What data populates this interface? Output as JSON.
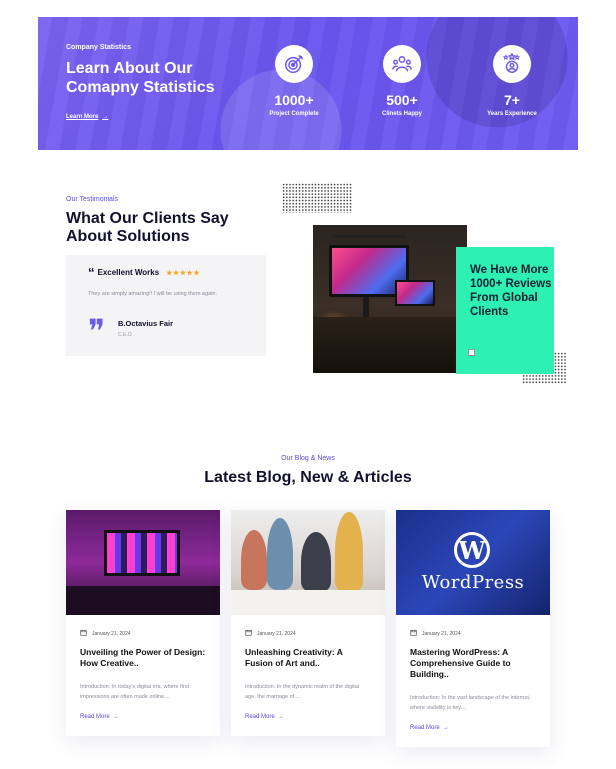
{
  "stats": {
    "kicker": "Company Statistics",
    "title": "Learn About Our Comapny Statistics",
    "learn_more": "Learn More",
    "items": [
      {
        "icon": "target-icon",
        "value": "1000+",
        "label": "Project Complete"
      },
      {
        "icon": "team-icon",
        "value": "500+",
        "label": "Clinets Happy"
      },
      {
        "icon": "award-icon",
        "value": "7+",
        "label": "Years Experience"
      }
    ]
  },
  "testimonials": {
    "kicker": "Our Testimonials",
    "title": "What Our Clients Say About Solutions",
    "card": {
      "heading": "Excellent Works",
      "rating": 5,
      "text": "They are simply amazing!! I will be using them again.",
      "name": "B.Octavius Fair",
      "role": "C.E.O"
    },
    "highlight": "We Have More 1000+ Reviews From Global Clients"
  },
  "blog": {
    "kicker": "Our Blog & News",
    "title": "Latest Blog, New & Articles",
    "posts": [
      {
        "date": "January 21, 2024",
        "title": "Unveiling the Power of Design: How Creative..",
        "excerpt": "Introduction: In today's digital era, where first impressions are often made online....",
        "more": "Read More"
      },
      {
        "date": "January 21, 2024",
        "title": "Unleashing Creativity: A Fusion of Art and..",
        "excerpt": "Introduction: In the dynamic realm of the digital age, the marriage of....",
        "more": "Read More"
      },
      {
        "date": "January 21, 2024",
        "title": "Mastering WordPress: A Comprehensive Guide to Building..",
        "excerpt": "Introduction: In the vast landscape of the internet, where visibility is key....",
        "more": "Read More",
        "image_text": "WordPress"
      }
    ]
  },
  "colors": {
    "accent": "#5b4ae8",
    "banner": "#6c5cf2",
    "highlight": "#2ff0b3",
    "star": "#f5a623"
  }
}
